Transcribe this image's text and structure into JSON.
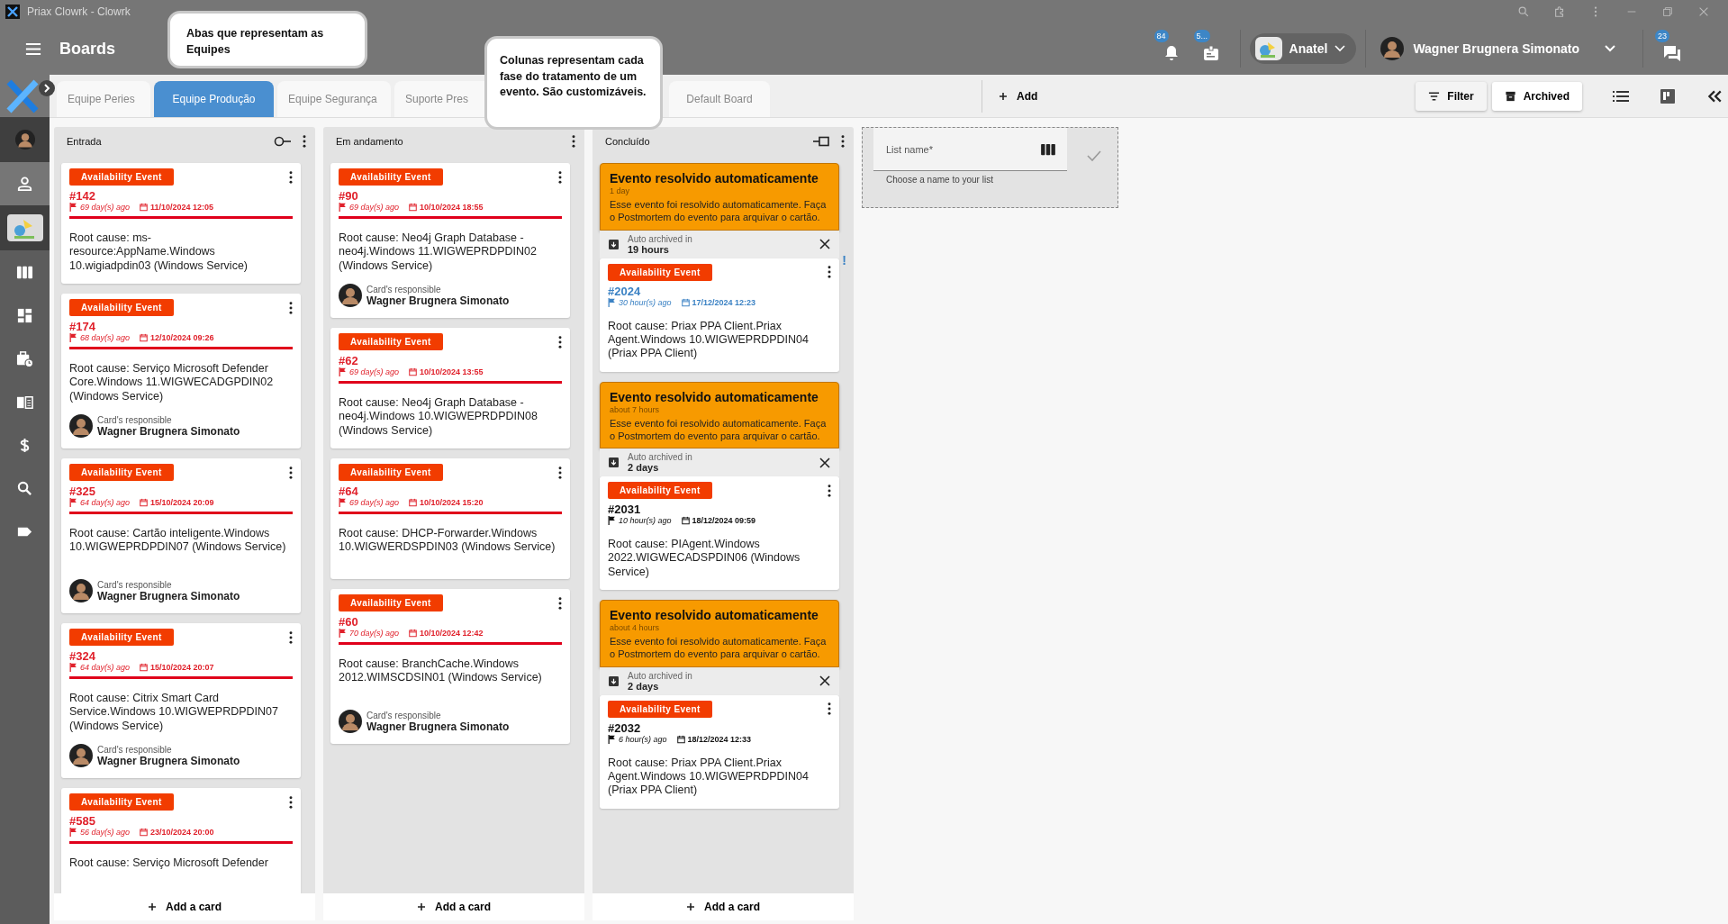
{
  "window": {
    "title": "Priax Clowrk - Clowrk"
  },
  "header": {
    "title": "Boards",
    "notifications": {
      "count": "84"
    },
    "tasks": {
      "count": "5..."
    },
    "organization": {
      "name": "Anatel"
    },
    "user": {
      "name": "Wagner Brugnera Simonato"
    },
    "messages": {
      "count": "23"
    }
  },
  "sidebar": {
    "items": [
      {
        "kind": "avatar",
        "selected": false
      },
      {
        "kind": "person",
        "selected": true
      },
      {
        "kind": "organization",
        "selected": false
      },
      {
        "kind": "columns",
        "selected": false
      },
      {
        "kind": "dashboard",
        "selected": false
      },
      {
        "kind": "briefcase",
        "selected": false
      },
      {
        "kind": "book",
        "selected": false
      },
      {
        "kind": "dollar",
        "selected": false
      },
      {
        "kind": "search",
        "selected": false
      },
      {
        "kind": "tag",
        "selected": false
      }
    ]
  },
  "tabs": [
    {
      "label": "Equipe Peries",
      "selected": false
    },
    {
      "label": "Equipe Produção",
      "selected": true
    },
    {
      "label": "Equipe Segurança",
      "selected": false
    },
    {
      "label": "Suporte Pres",
      "selected": false
    },
    {
      "label": "Default Board",
      "selected": false
    }
  ],
  "toolbar": {
    "add": "Add",
    "filter": "Filter",
    "archived": "Archived"
  },
  "callouts": [
    {
      "text": "Abas que representam as Equipes"
    },
    {
      "text": "Colunas representam cada fase do tratamento de um evento. São customizáveis."
    }
  ],
  "columns": [
    {
      "title": "Entrada",
      "kind": "filter",
      "add_label": "Add a card",
      "cards": [
        {
          "tag": "Availability Event",
          "number": "#142",
          "color": "#e0212b",
          "overdue": true,
          "age": "69 day(s) ago",
          "date": "11/10/2024 12:05",
          "text": "Root cause: ms-resource:AppName.Windows 10.wigiadpdin03 (Windows Service)"
        },
        {
          "tag": "Availability Event",
          "number": "#174",
          "color": "#e0212b",
          "overdue": true,
          "age": "68 day(s) ago",
          "date": "12/10/2024 09:26",
          "text": "Root cause: Serviço Microsoft Defender Core.Windows 11.WIGWECADGPDIN02 (Windows Service)",
          "responsible": {
            "label": "Card's responsible",
            "name": "Wagner Brugnera Simonato"
          }
        },
        {
          "tag": "Availability Event",
          "number": "#325",
          "color": "#e0212b",
          "overdue": true,
          "age": "64 day(s) ago",
          "date": "15/10/2024 20:09",
          "text": "Root cause: Cartão inteligente.Windows 10.WIGWEPRDPDIN07 (Windows Service)",
          "responsible": {
            "label": "Card's responsible",
            "name": "Wagner Brugnera Simonato"
          }
        },
        {
          "tag": "Availability Event",
          "number": "#324",
          "color": "#e0212b",
          "overdue": true,
          "age": "64 day(s) ago",
          "date": "15/10/2024 20:07",
          "text": "Root cause: Citrix Smart Card Service.Windows 10.WIGWEPRDPDIN07 (Windows Service)",
          "responsible": {
            "label": "Card's responsible",
            "name": "Wagner Brugnera Simonato"
          }
        },
        {
          "tag": "Availability Event",
          "number": "#585",
          "color": "#e0212b",
          "overdue": true,
          "age": "56 day(s) ago",
          "date": "23/10/2024 20:00",
          "text": "Root cause: Serviço Microsoft Defender"
        }
      ]
    },
    {
      "title": "Em andamento",
      "kind": "plain",
      "add_label": "Add a card",
      "cards": [
        {
          "tag": "Availability Event",
          "number": "#90",
          "color": "#e0212b",
          "overdue": true,
          "age": "69 day(s) ago",
          "date": "10/10/2024 18:55",
          "text": "Root cause: Neo4j Graph Database - neo4j.Windows 11.WIGWEPRDPDIN02 (Windows Service)",
          "responsible": {
            "label": "Card's responsible",
            "name": "Wagner Brugnera Simonato"
          }
        },
        {
          "tag": "Availability Event",
          "number": "#62",
          "color": "#e0212b",
          "overdue": true,
          "age": "69 day(s) ago",
          "date": "10/10/2024 13:55",
          "text": "Root cause: Neo4j Graph Database - neo4j.Windows 10.WIGWEPRDPDIN08 (Windows Service)"
        },
        {
          "tag": "Availability Event",
          "number": "#64",
          "color": "#e0212b",
          "overdue": true,
          "age": "69 day(s) ago",
          "date": "10/10/2024 15:20",
          "text": "Root cause: DHCP-Forwarder.Windows 10.WIGWERDSPDIN03 (Windows Service)"
        },
        {
          "tag": "Availability Event",
          "number": "#60",
          "color": "#e0212b",
          "overdue": true,
          "age": "70 day(s) ago",
          "date": "10/10/2024 12:42",
          "text": "Root cause: BranchCache.Windows 2012.WIMSCDSIN01 (Windows Service)",
          "responsible": {
            "label": "Card's responsible",
            "name": "Wagner Brugnera Simonato"
          }
        }
      ]
    },
    {
      "title": "Concluído",
      "kind": "pinned",
      "add_label": "Add a card",
      "cards": [
        {
          "notice": {
            "title": "Evento resolvido automaticamente",
            "time": "1 day",
            "text": "Esse evento foi resolvido automaticamente. Faça o Postmortem do evento para arquivar o cartão."
          },
          "archive": {
            "label": "Auto archived in",
            "value": "19 hours"
          },
          "tag": "Availability Event",
          "number": "#2024",
          "color": "#3b82c4",
          "overdue": false,
          "alert": "!",
          "age": "30 hour(s) ago",
          "date": "17/12/2024 12:23",
          "text": "Root cause: Priax PPA Client.Priax Agent.Windows 10.WIGWEPRDPDIN04 (Priax PPA Client)"
        },
        {
          "notice": {
            "title": "Evento resolvido automaticamente",
            "time": "about 7 hours",
            "text": "Esse evento foi resolvido automaticamente. Faça o Postmortem do evento para arquivar o cartão."
          },
          "archive": {
            "label": "Auto archived in",
            "value": "2 days"
          },
          "tag": "Availability Event",
          "number": "#2031",
          "color": "#111111",
          "overdue": false,
          "age": "10 hour(s) ago",
          "date": "18/12/2024 09:59",
          "text": "Root cause: PIAgent.Windows 2022.WIGWECADSPDIN06 (Windows Service)"
        },
        {
          "notice": {
            "title": "Evento resolvido automaticamente",
            "time": "about 4 hours",
            "text": "Esse evento foi resolvido automaticamente. Faça o Postmortem do evento para arquivar o cartão."
          },
          "archive": {
            "label": "Auto archived in",
            "value": "2 days"
          },
          "tag": "Availability Event",
          "number": "#2032",
          "color": "#111111",
          "overdue": false,
          "age": "6 hour(s) ago",
          "date": "18/12/2024 12:33",
          "text": "Root cause: Priax PPA Client.Priax Agent.Windows 10.WIGWEPRDPDIN04 (Priax PPA Client)"
        }
      ]
    }
  ],
  "new_list": {
    "placeholder": "List name*",
    "hint": "Choose a name to your list"
  }
}
